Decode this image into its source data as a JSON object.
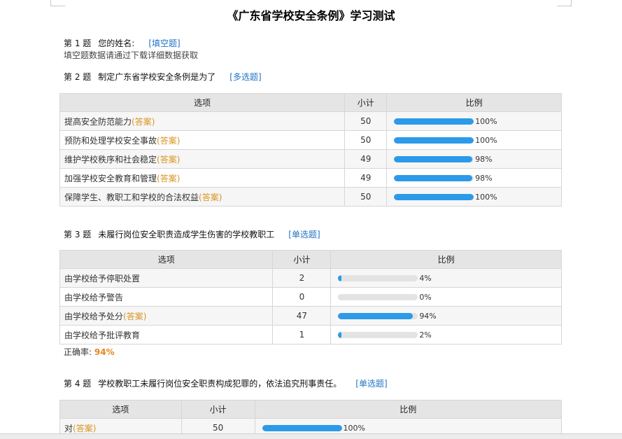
{
  "title": "《广东省学校安全条例》学习测试",
  "answer_tag": "(答案)",
  "q1": {
    "no": "第 1 题",
    "text": "您的姓名:",
    "tag": "[填空题]",
    "note": "填空题数据请通过下载详细数据获取"
  },
  "q2": {
    "no": "第 2 题",
    "text": "制定广东省学校安全条例是为了",
    "tag": "[多选题]",
    "headers": [
      "选项",
      "小计",
      "比例"
    ],
    "rows": [
      {
        "option": "提高安全防范能力",
        "answer": true,
        "count": 50,
        "percent": 100,
        "percent_label": "100%"
      },
      {
        "option": "预防和处理学校安全事故",
        "answer": true,
        "count": 50,
        "percent": 100,
        "percent_label": "100%"
      },
      {
        "option": "维护学校秩序和社会稳定",
        "answer": true,
        "count": 49,
        "percent": 98,
        "percent_label": "98%"
      },
      {
        "option": "加强学校安全教育和管理",
        "answer": true,
        "count": 49,
        "percent": 98,
        "percent_label": "98%"
      },
      {
        "option": "保障学生、教职工和学校的合法权益",
        "answer": true,
        "count": 50,
        "percent": 100,
        "percent_label": "100%"
      }
    ]
  },
  "q3": {
    "no": "第 3 题",
    "text": "未履行岗位安全职责造成学生伤害的学校教职工",
    "tag": "[单选题]",
    "headers": [
      "选项",
      "小计",
      "比例"
    ],
    "rows": [
      {
        "option": "由学校给予停职处置",
        "answer": false,
        "count": 2,
        "percent": 4,
        "percent_label": "4%"
      },
      {
        "option": "由学校给予警告",
        "answer": false,
        "count": 0,
        "percent": 0,
        "percent_label": "0%"
      },
      {
        "option": "由学校给予处分",
        "answer": true,
        "count": 47,
        "percent": 94,
        "percent_label": "94%"
      },
      {
        "option": "由学校给予批评教育",
        "answer": false,
        "count": 1,
        "percent": 2,
        "percent_label": "2%"
      }
    ],
    "accuracy_label": "正确率:",
    "accuracy_value": "94%"
  },
  "q4": {
    "no": "第 4 题",
    "text": "学校教职工未履行岗位安全职责构成犯罪的，依法追究刑事责任。",
    "tag": "[单选题]",
    "headers": [
      "选项",
      "小计",
      "比例"
    ],
    "rows": [
      {
        "option": "对",
        "answer": true,
        "count": 50,
        "percent": 100,
        "percent_label": "100%"
      }
    ]
  },
  "colors": {
    "bar_fill": "#2c9ae8",
    "bar_track": "#e3e3e3",
    "answer": "#d89522",
    "tag": "#1f73c4",
    "accuracy": "#e8861a"
  }
}
